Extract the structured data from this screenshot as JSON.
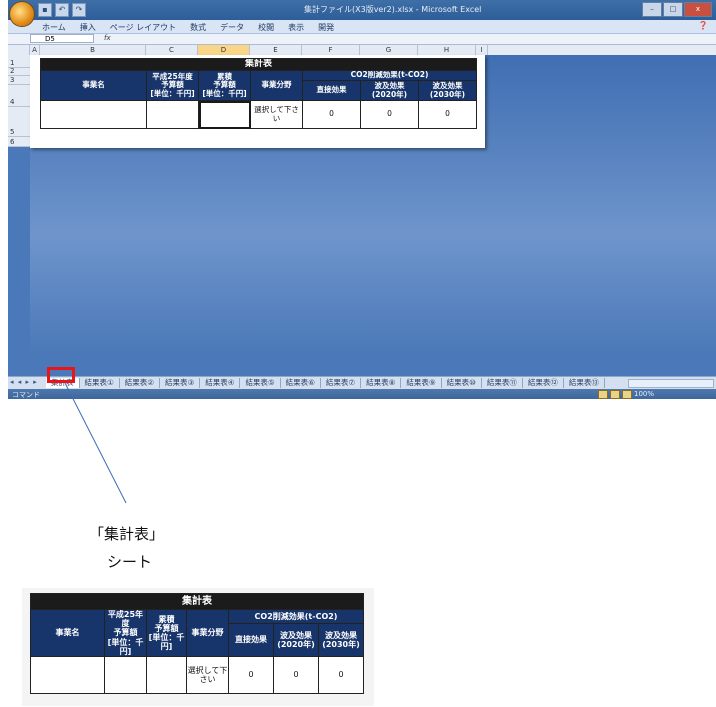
{
  "window": {
    "title": "集計ファイル(X3版ver2).xlsx - Microsoft Excel",
    "controls": [
      "–",
      "□",
      "x"
    ]
  },
  "ribbon": {
    "tabs": [
      "ホーム",
      "挿入",
      "ページ レイアウト",
      "数式",
      "データ",
      "校閲",
      "表示",
      "開発"
    ]
  },
  "formula_bar": {
    "name_box": "D5",
    "fx": "fx"
  },
  "columns": [
    "A",
    "B",
    "C",
    "D",
    "E",
    "F",
    "G",
    "H",
    "I"
  ],
  "selected_column": "D",
  "rows": [
    "1",
    "2",
    "3",
    "4",
    "5",
    "6"
  ],
  "summary_table": {
    "title": "集計表",
    "headers": {
      "project": "事業名",
      "budget": "平成25年度\n予算額\n[単位：千円]",
      "cumulative": "累積\n予算額\n[単位：千円]",
      "field": "事業分野",
      "co2_group": "CO2削減効果(t-CO2)",
      "direct": "直接効果",
      "spread_2020": "波及効果\n(2020年)",
      "spread_2030": "波及効果\n(2030年)"
    },
    "row": {
      "project": "",
      "budget": "",
      "cumulative": "",
      "field": "選択して下さい",
      "direct": "0",
      "spread_2020": "0",
      "spread_2030": "0"
    }
  },
  "sheet_tabs": [
    "集計表",
    "結果表①",
    "結果表②",
    "結果表③",
    "結果表④",
    "結果表⑤",
    "結果表⑥",
    "結果表⑦",
    "結果表⑧",
    "結果表⑨",
    "結果表⑩",
    "結果表⑪",
    "結果表⑫",
    "結果表⑬"
  ],
  "active_sheet_tab": "集計表",
  "tab_nav": "◂ ◂ ▸ ▸",
  "status": {
    "mode": "コマンド",
    "zoom": "100%"
  },
  "callout": {
    "label": "「集計表」",
    "sub": "シート",
    "highlight_color": "#e8161b"
  },
  "colors": {
    "header_navy": "#17346b",
    "title_black": "#1b1b1b",
    "sheet_background": "#4a78b8"
  }
}
